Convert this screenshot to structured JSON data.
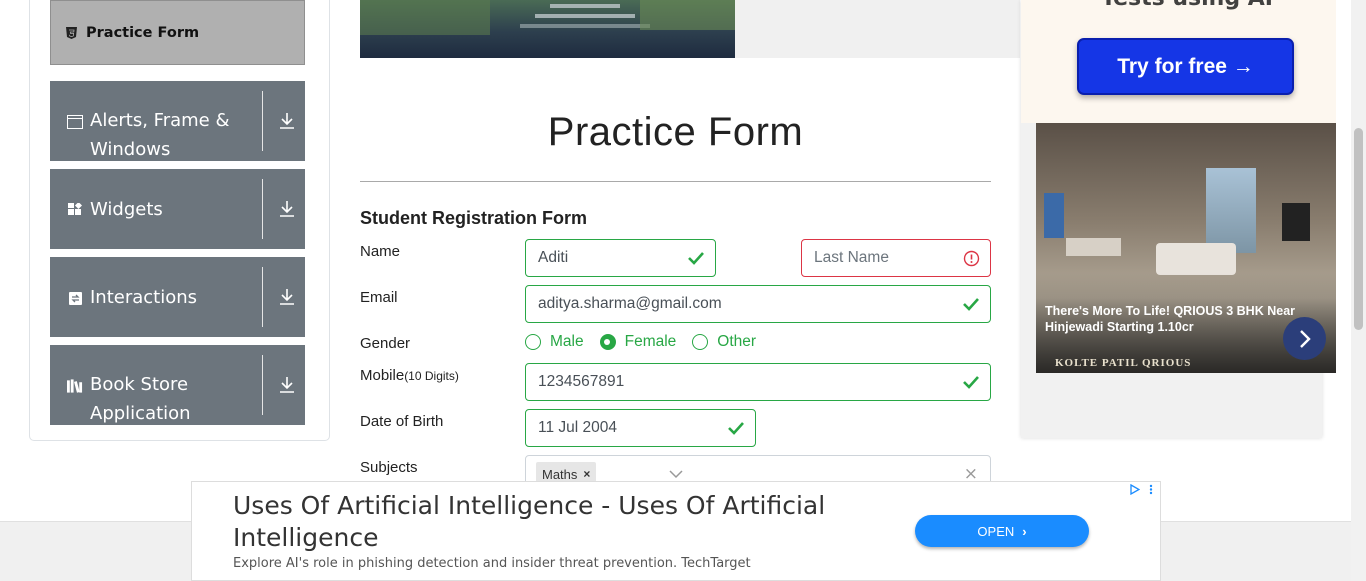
{
  "sidebar": {
    "active_item": "Practice Form",
    "groups": [
      {
        "label": "Alerts, Frame & Windows"
      },
      {
        "label": "Widgets"
      },
      {
        "label": "Interactions"
      },
      {
        "label": "Book Store Application"
      }
    ]
  },
  "main": {
    "page_title": "Practice Form",
    "form_heading": "Student Registration Form",
    "labels": {
      "name": "Name",
      "email": "Email",
      "gender": "Gender",
      "mobile": "Mobile",
      "mobile_hint": "(10 Digits)",
      "dob": "Date of Birth",
      "subjects": "Subjects"
    },
    "fields": {
      "first_name": "Aditi",
      "last_name_placeholder": "Last Name",
      "email": "aditya.sharma@gmail.com",
      "mobile": "1234567891",
      "dob": "11 Jul 2004"
    },
    "gender_options": [
      "Male",
      "Female",
      "Other"
    ],
    "gender_selected": "Female",
    "subjects": [
      "Maths"
    ]
  },
  "right_ads": {
    "tagline": "Tests using AI",
    "try_button": "Try for free →",
    "property_text": "There's More To Life! QRIOUS 3 BHK Near Hinjewadi Starting 1.10cr",
    "property_brand": "KOLTE PATIL QRIOUS"
  },
  "bottom_ad": {
    "title": "Uses Of Artificial Intelligence - Uses Of Artificial Intelligence",
    "description": "Explore AI's role in phishing detection and insider threat prevention. TechTarget",
    "open_label": "OPEN"
  },
  "colors": {
    "valid": "#28a745",
    "invalid": "#dc3545",
    "sidebar_group": "#6c757d",
    "active_item": "#b0b0b0",
    "try_button": "#1536e6",
    "open_button": "#1a8cff"
  }
}
